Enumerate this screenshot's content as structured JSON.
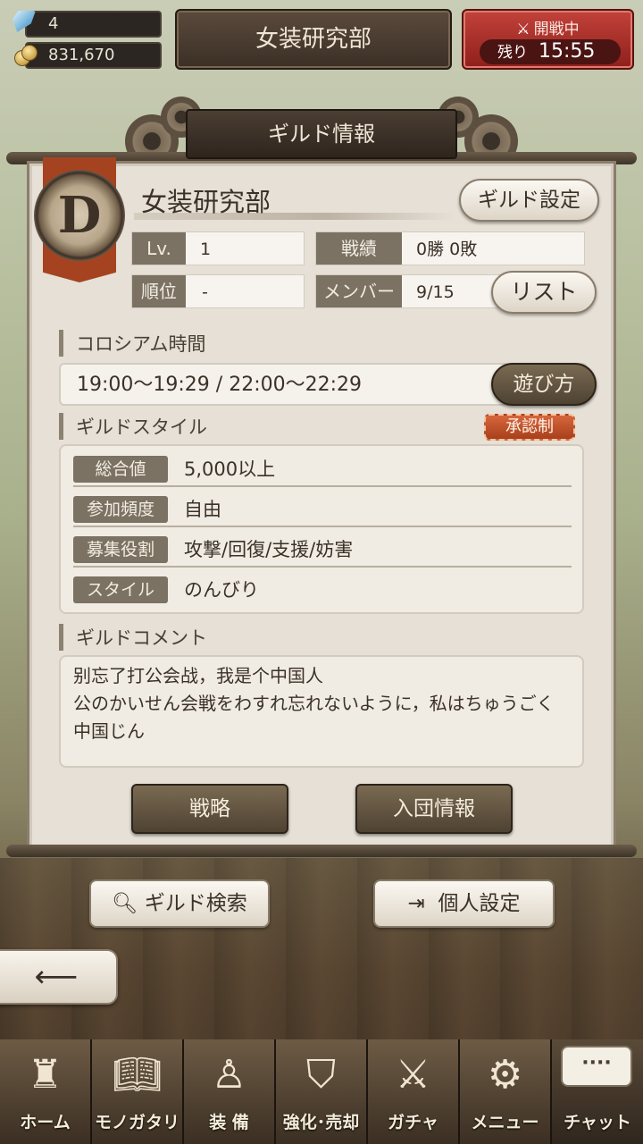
{
  "header": {
    "gems": "4",
    "gold": "831,670",
    "guild_title": "女装研究部",
    "battle": {
      "status": "開戦中",
      "remaining_label": "残り",
      "remaining_time": "15:55"
    }
  },
  "panel": {
    "title": "ギルド情報",
    "emblem_rank": "D",
    "guild_name": "女装研究部",
    "guild_settings_button": "ギルド設定",
    "stats": {
      "level_label": "Lv.",
      "level_value": "1",
      "record_label": "戦績",
      "record_value": "0勝 0敗",
      "rank_label": "順位",
      "rank_value": "-",
      "members_label": "メンバー",
      "members_value": "9/15"
    },
    "list_button": "リスト",
    "colosseum": {
      "heading": "コロシアム時間",
      "times": "19:00〜19:29 / 22:00〜22:29",
      "howto_button": "遊び方"
    },
    "style": {
      "heading": "ギルドスタイル",
      "approval_badge": "承認制",
      "rows": [
        {
          "label": "総合値",
          "value": "5,000以上"
        },
        {
          "label": "参加頻度",
          "value": "自由"
        },
        {
          "label": "募集役割",
          "value": "攻撃/回復/支援/妨害"
        },
        {
          "label": "スタイル",
          "value": "のんびり"
        }
      ]
    },
    "comment": {
      "heading": "ギルドコメント",
      "text": "别忘了打公会战，我是个中国人\n公のかいせん会戦をわすれ忘れないように，私はちゅうごく中国じん"
    },
    "strategy_button": "戦略",
    "join_info_button": "入団情報"
  },
  "actions": {
    "guild_search": "ギルド検索",
    "personal_settings": "個人設定"
  },
  "nav": {
    "items": [
      {
        "label": "ホーム",
        "icon": "castle-icon"
      },
      {
        "label": "モノガタリ",
        "icon": "book-icon"
      },
      {
        "label": "装 備",
        "icon": "puppet-icon"
      },
      {
        "label": "強化･売却",
        "icon": "shield-icon"
      },
      {
        "label": "ガチャ",
        "icon": "swords-icon"
      },
      {
        "label": "メニュー",
        "icon": "gear-icon"
      },
      {
        "label": "チャット",
        "icon": "chat-icon"
      }
    ],
    "chat_bubble": "····"
  }
}
